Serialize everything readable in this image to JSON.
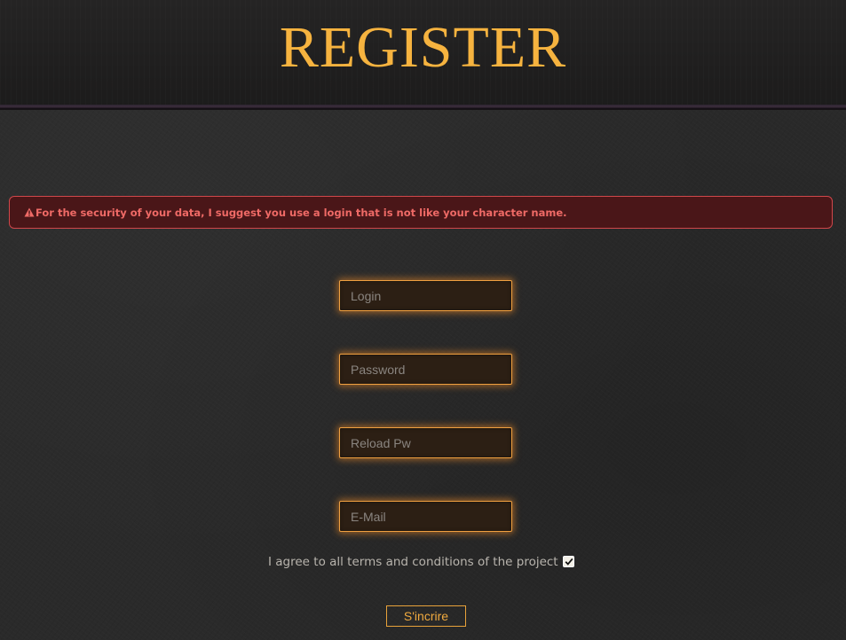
{
  "header": {
    "title": "REGISTER"
  },
  "alert": {
    "icon": "warning-triangle-icon",
    "message": "For the security of your data, I suggest you use a login that is not like your character name."
  },
  "form": {
    "login": {
      "placeholder": "Login",
      "value": ""
    },
    "password": {
      "placeholder": "Password",
      "value": ""
    },
    "reload_password": {
      "placeholder": "Reload Pw",
      "value": ""
    },
    "email": {
      "placeholder": "E-Mail",
      "value": ""
    },
    "terms_label": "I agree to all terms and conditions of the project",
    "terms_checked": true,
    "submit_label": "S'incrire"
  },
  "colors": {
    "title": "#f6b33f",
    "accent": "#f0a040",
    "alert_bg": "#4a1618",
    "alert_border": "#d0474b",
    "alert_text": "#ef6a66"
  }
}
